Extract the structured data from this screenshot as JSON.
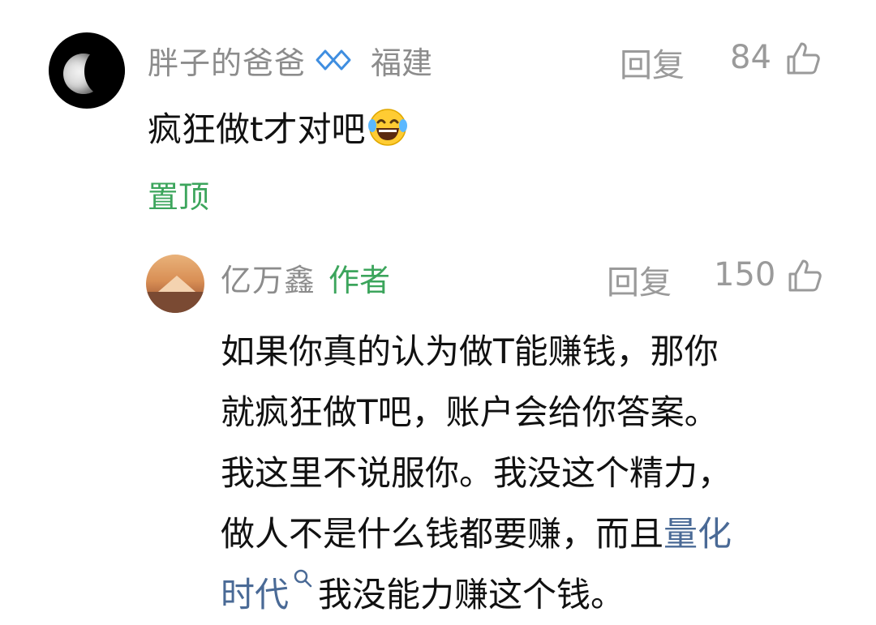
{
  "comment": {
    "username": "胖子的爸爸",
    "location": "福建",
    "reply_label": "回复",
    "like_count": "84",
    "text": "疯狂做t才对吧",
    "emoji": "laughing-tears-emoji",
    "pinned_label": "置顶"
  },
  "reply": {
    "username": "亿万鑫",
    "author_tag": "作者",
    "reply_label": "回复",
    "like_count": "150",
    "lines": [
      "如果你真的认为做T能赚钱，那你",
      "就疯狂做T吧，账户会给你答案。",
      "我这里不说服你。我没这个精力，",
      "做人不是什么钱都要赚，而且"
    ],
    "link_part1": "量化",
    "link_part2": "时代",
    "tail_text": "我没能力赚这个钱。"
  },
  "colors": {
    "meta_gray": "#8c8c8c",
    "green_accent": "#3ca55c",
    "link_blue": "#4a6a96"
  }
}
